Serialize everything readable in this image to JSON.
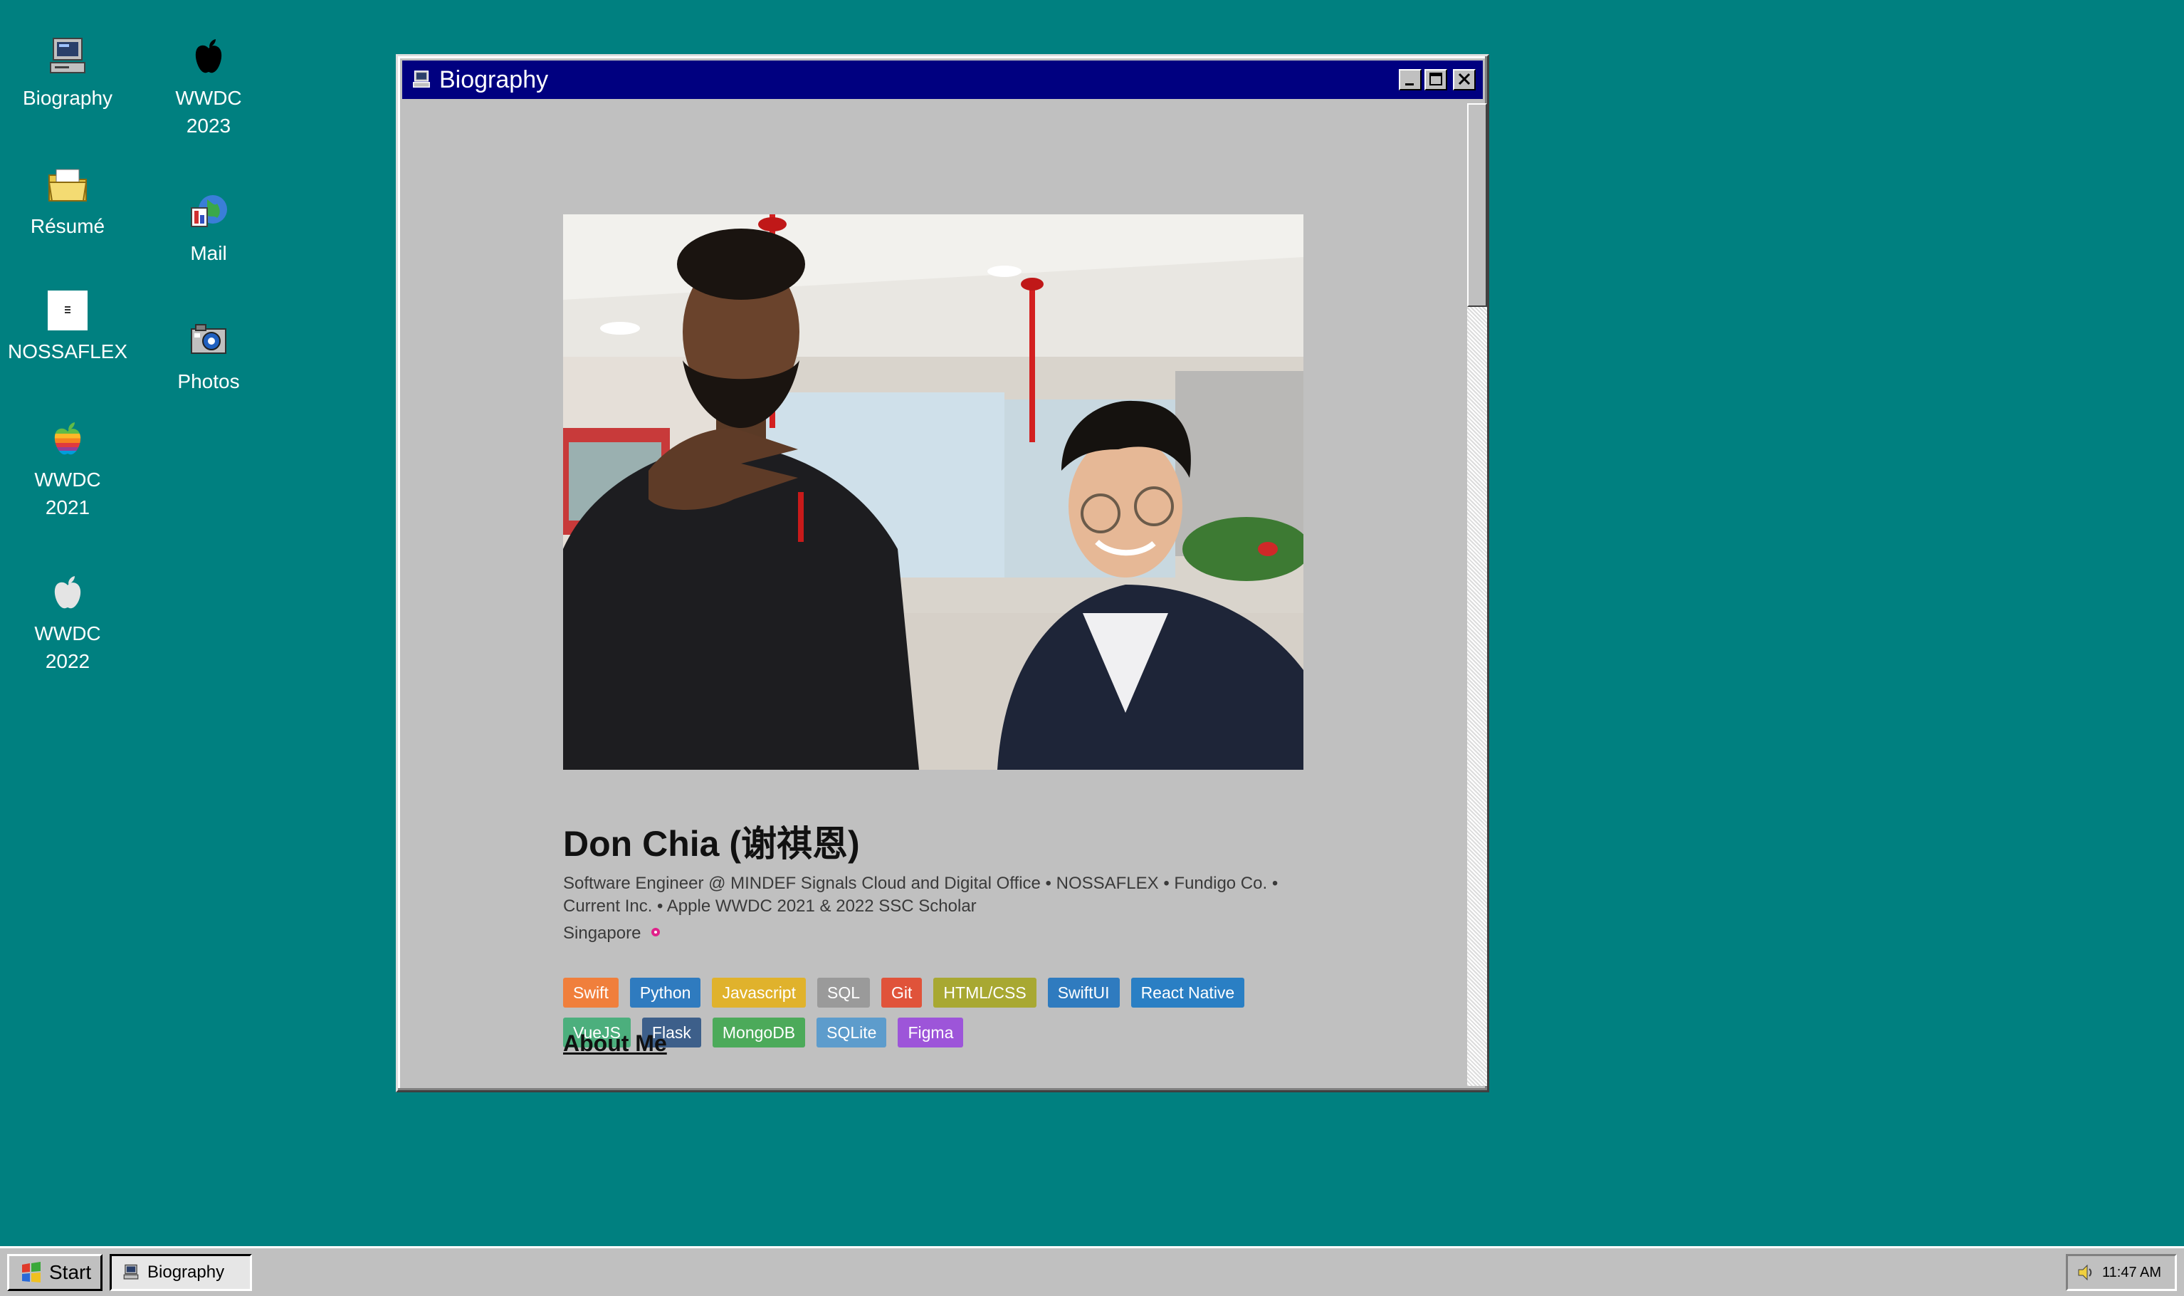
{
  "desktop": {
    "background_color": "#008080",
    "icons": [
      {
        "label": "Biography",
        "icon": "computer-icon"
      },
      {
        "label": "WWDC 2023",
        "icon": "apple-black-icon"
      },
      {
        "label": "Résumé",
        "icon": "folder-icon"
      },
      {
        "label": "Mail",
        "icon": "mail-icon"
      },
      {
        "label": "NOSSAFLEX",
        "icon": "nossaflex-icon"
      },
      {
        "label": "Photos",
        "icon": "camera-icon"
      },
      {
        "label": "WWDC 2021",
        "icon": "apple-rainbow-icon"
      },
      {
        "label": "WWDC 2022",
        "icon": "apple-white-icon"
      }
    ]
  },
  "window": {
    "title": "Biography",
    "title_icon": "computer-icon",
    "title_bar_color": "#000080",
    "controls": [
      "minimize-icon",
      "maximize-icon",
      "close-icon"
    ]
  },
  "profile": {
    "name": "Don Chia (谢祺恩)",
    "bio": "Software Engineer @ MINDEF Signals Cloud and Digital Office • NOSSAFLEX • Fundigo Co. • Current Inc. •  Apple WWDC 2021 & 2022 SSC Scholar",
    "location": "Singapore",
    "location_pin_color": "#e0218a",
    "tags": [
      {
        "label": "Swift",
        "color": "#f07f3c"
      },
      {
        "label": "Python",
        "color": "#2f7bbf"
      },
      {
        "label": "Javascript",
        "color": "#e0b22c"
      },
      {
        "label": "SQL",
        "color": "#9a9a9a"
      },
      {
        "label": "Git",
        "color": "#e0533a"
      },
      {
        "label": "HTML/CSS",
        "color": "#a8a832"
      },
      {
        "label": "SwiftUI",
        "color": "#2f7bbf"
      },
      {
        "label": "React Native",
        "color": "#2a7fc4"
      },
      {
        "label": "VueJS",
        "color": "#4caf7d"
      },
      {
        "label": "Flask",
        "color": "#3d5f8a"
      },
      {
        "label": "MongoDB",
        "color": "#4caa5a"
      },
      {
        "label": "SQLite",
        "color": "#5d9ccc"
      },
      {
        "label": "Figma",
        "color": "#9d55d9"
      }
    ],
    "about_heading": "About Me"
  },
  "taskbar": {
    "start_label": "Start",
    "tasks": [
      {
        "label": "Biography",
        "icon": "computer-icon"
      }
    ],
    "time": "11:47 AM",
    "tray_icon": "speaker-icon"
  }
}
